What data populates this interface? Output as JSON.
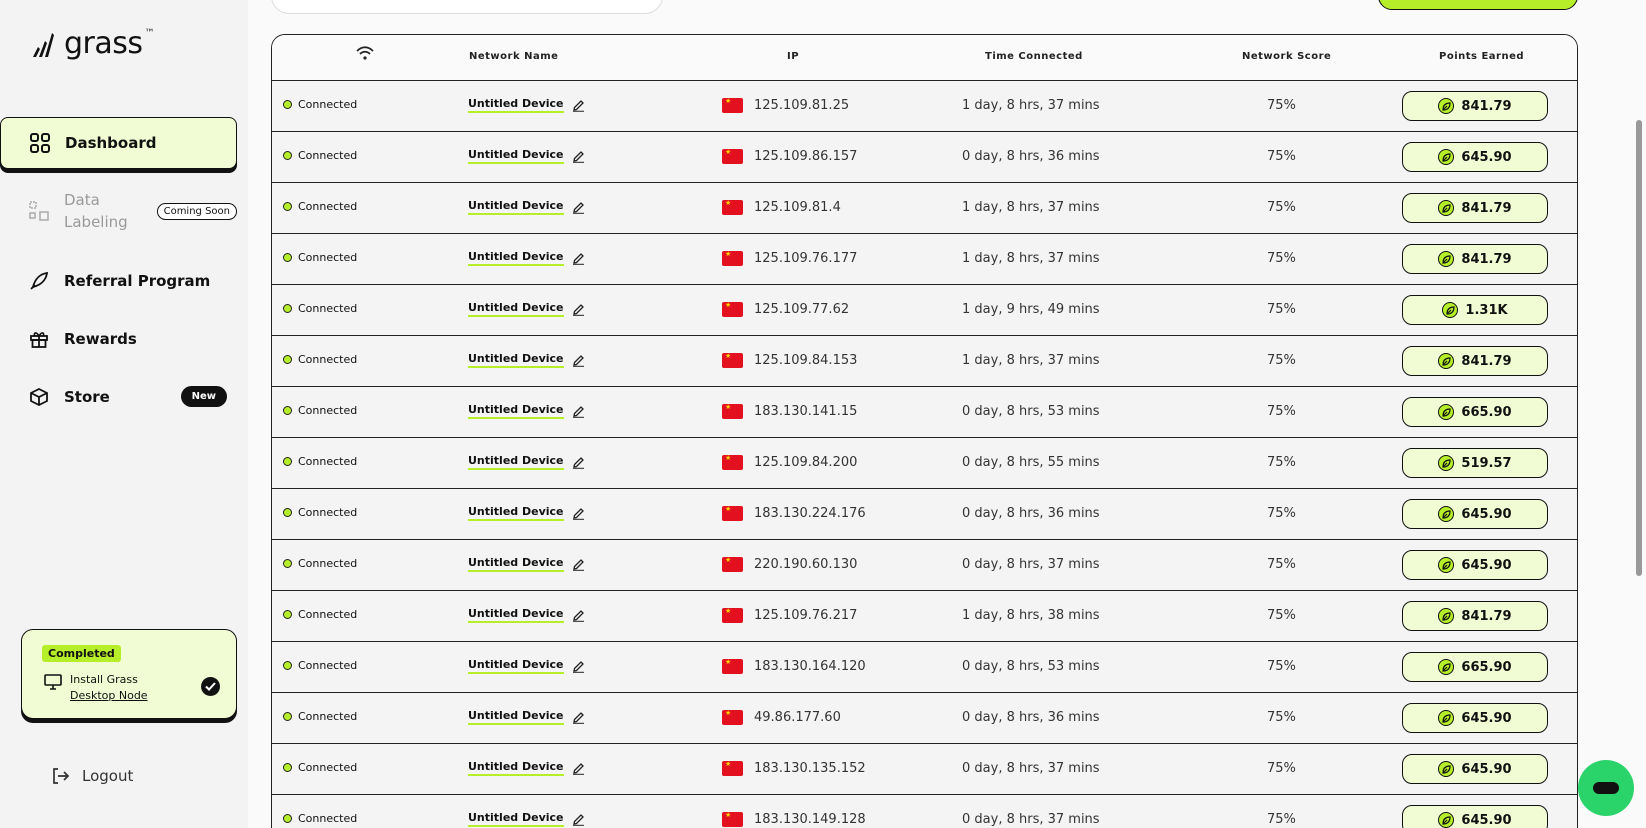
{
  "brand": {
    "name": "grass",
    "tm": "™"
  },
  "sidebar": {
    "items": [
      {
        "label": "Dashboard",
        "icon": "grid-icon"
      },
      {
        "label": "Data Labeling",
        "icon": "labeling-icon",
        "badge": "Coming Soon"
      },
      {
        "label": "Referral Program",
        "icon": "rocket-icon"
      },
      {
        "label": "Rewards",
        "icon": "gift-icon"
      },
      {
        "label": "Store",
        "icon": "box-icon",
        "badge": "New"
      }
    ],
    "task": {
      "status": "Completed",
      "line1": "Install Grass",
      "line2": "Desktop Node"
    },
    "logout": "Logout"
  },
  "table": {
    "headers": {
      "name": "Network Name",
      "ip": "IP",
      "time": "Time Connected",
      "score": "Network Score",
      "points": "Points Earned"
    },
    "rows": [
      {
        "status": "Connected",
        "name": "Untitled Device",
        "ip": "125.109.81.25",
        "time": "1 day, 8 hrs, 37 mins",
        "score": "75%",
        "points": "841.79"
      },
      {
        "status": "Connected",
        "name": "Untitled Device",
        "ip": "125.109.86.157",
        "time": "0 day, 8 hrs, 36 mins",
        "score": "75%",
        "points": "645.90"
      },
      {
        "status": "Connected",
        "name": "Untitled Device",
        "ip": "125.109.81.4",
        "time": "1 day, 8 hrs, 37 mins",
        "score": "75%",
        "points": "841.79"
      },
      {
        "status": "Connected",
        "name": "Untitled Device",
        "ip": "125.109.76.177",
        "time": "1 day, 8 hrs, 37 mins",
        "score": "75%",
        "points": "841.79"
      },
      {
        "status": "Connected",
        "name": "Untitled Device",
        "ip": "125.109.77.62",
        "time": "1 day, 9 hrs, 49 mins",
        "score": "75%",
        "points": "1.31K"
      },
      {
        "status": "Connected",
        "name": "Untitled Device",
        "ip": "125.109.84.153",
        "time": "1 day, 8 hrs, 37 mins",
        "score": "75%",
        "points": "841.79"
      },
      {
        "status": "Connected",
        "name": "Untitled Device",
        "ip": "183.130.141.15",
        "time": "0 day, 8 hrs, 53 mins",
        "score": "75%",
        "points": "665.90"
      },
      {
        "status": "Connected",
        "name": "Untitled Device",
        "ip": "125.109.84.200",
        "time": "0 day, 8 hrs, 55 mins",
        "score": "75%",
        "points": "519.57"
      },
      {
        "status": "Connected",
        "name": "Untitled Device",
        "ip": "183.130.224.176",
        "time": "0 day, 8 hrs, 36 mins",
        "score": "75%",
        "points": "645.90"
      },
      {
        "status": "Connected",
        "name": "Untitled Device",
        "ip": "220.190.60.130",
        "time": "0 day, 8 hrs, 37 mins",
        "score": "75%",
        "points": "645.90"
      },
      {
        "status": "Connected",
        "name": "Untitled Device",
        "ip": "125.109.76.217",
        "time": "1 day, 8 hrs, 38 mins",
        "score": "75%",
        "points": "841.79"
      },
      {
        "status": "Connected",
        "name": "Untitled Device",
        "ip": "183.130.164.120",
        "time": "0 day, 8 hrs, 53 mins",
        "score": "75%",
        "points": "665.90"
      },
      {
        "status": "Connected",
        "name": "Untitled Device",
        "ip": "49.86.177.60",
        "time": "0 day, 8 hrs, 36 mins",
        "score": "75%",
        "points": "645.90"
      },
      {
        "status": "Connected",
        "name": "Untitled Device",
        "ip": "183.130.135.152",
        "time": "0 day, 8 hrs, 37 mins",
        "score": "75%",
        "points": "645.90"
      },
      {
        "status": "Connected",
        "name": "Untitled Device",
        "ip": "183.130.149.128",
        "time": "0 day, 8 hrs, 37 mins",
        "score": "75%",
        "points": "645.90"
      }
    ]
  },
  "colors": {
    "accent": "#b6ef2a",
    "accent_light": "#f1fcd5",
    "flag_red": "#e3101f"
  }
}
